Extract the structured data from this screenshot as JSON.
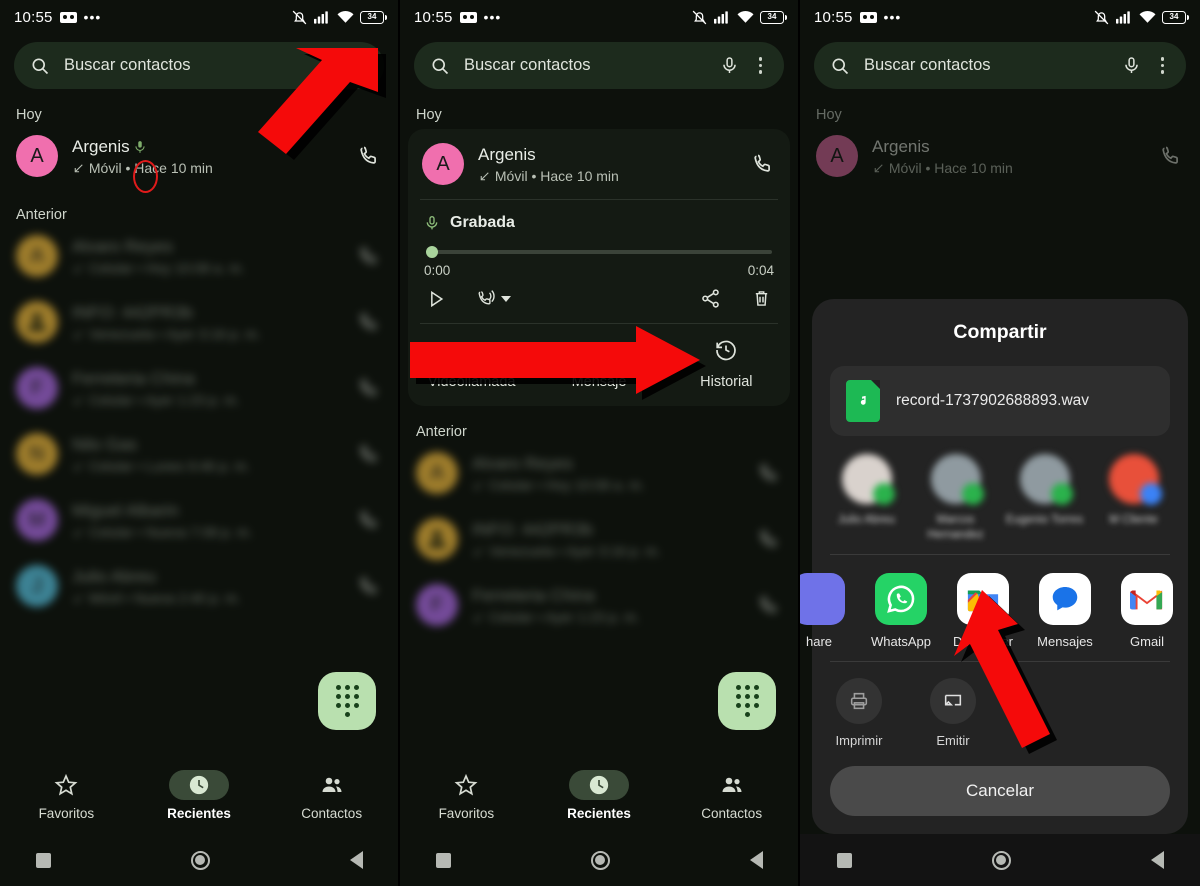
{
  "status_bar": {
    "time": "10:55",
    "battery_percent": "34",
    "icons": [
      "voicemail-tape-icon",
      "overflow-dots-icon",
      "ringer-off-icon",
      "signal-icon",
      "wifi-icon",
      "battery-icon"
    ]
  },
  "search": {
    "placeholder": "Buscar contactos",
    "icons": [
      "search-icon",
      "mic-icon",
      "kebab-menu-icon"
    ]
  },
  "sections": {
    "today": "Hoy",
    "previous": "Anterior"
  },
  "highlight_call": {
    "name": "Argenis",
    "subtitle": "Móvil • Hace 10 min",
    "avatar_letter": "A",
    "avatar_color": "#f06fae",
    "direction_icon": "incoming-call-arrow-icon",
    "recorded_icon": "mic-icon"
  },
  "recording": {
    "label": "Grabada",
    "time_start": "0:00",
    "time_end": "0:04",
    "progress_percent": 0,
    "controls": [
      "play-icon",
      "speaker-dropdown-icon",
      "share-icon",
      "delete-icon"
    ]
  },
  "call_actions": [
    {
      "label": "Videollamada",
      "icon": "video-camera-icon"
    },
    {
      "label": "Mensaje",
      "icon": "message-bubble-icon"
    },
    {
      "label": "Historial",
      "icon": "history-clock-icon"
    }
  ],
  "previous_calls": [
    {
      "letter": "A",
      "color": "#f7bf3f",
      "name": "Alvaro Reyes",
      "sub": "Celular • Hoy 10:08 a. m.",
      "type": "letter"
    },
    {
      "letter": "",
      "color": "#f7bf3f",
      "name": "INFO: 442PR3b",
      "sub": "Venezuela • Ayer 3:16 p. m.",
      "type": "person"
    },
    {
      "letter": "F",
      "color": "#b46ef0",
      "name": "Ferreteria China",
      "sub": "Celular • Ayer 1:23 p. m.",
      "type": "letter"
    },
    {
      "letter": "N",
      "color": "#f7bf3f",
      "name": "Nilo Gas",
      "sub": "Celular • Lunes 9:46 p. m.",
      "type": "letter"
    },
    {
      "letter": "M",
      "color": "#b46ef0",
      "name": "Miguel Albarin",
      "sub": "Celular • Nueva 7:08 p. m.",
      "type": "letter"
    },
    {
      "letter": "J",
      "color": "#5ac8e8",
      "name": "Julio Abreu",
      "sub": "Móvil • Nueva 2:40 p. m.",
      "type": "letter"
    }
  ],
  "bottom_nav": [
    {
      "label": "Favoritos",
      "icon": "star-icon",
      "active": false
    },
    {
      "label": "Recientes",
      "icon": "clock-icon",
      "active": true
    },
    {
      "label": "Contactos",
      "icon": "people-icon",
      "active": false
    }
  ],
  "system_nav": [
    "recents-square-icon",
    "home-circle-icon",
    "back-triangle-icon"
  ],
  "fab": {
    "icon": "dialpad-icon",
    "color": "#b9e0af"
  },
  "share_sheet": {
    "title": "Compartir",
    "file_name": "record-1737902688893.wav",
    "file_icon": "audio-file-icon",
    "suggestions": [
      {
        "label": "Julio Abreu",
        "color": "#d9d2cd",
        "badge": "#2bb24c"
      },
      {
        "label": "Marcos Hernandez",
        "color": "#8f9aa0",
        "badge": "#2bb24c"
      },
      {
        "label": "Eugenio Torres",
        "color": "#8f9aa0",
        "badge": "#2bb24c"
      },
      {
        "label": "M Cliente",
        "color": "#e8503a",
        "badge": "#3b82f6"
      }
    ],
    "apps": [
      {
        "label": "hare",
        "icon": "nearby-share-icon"
      },
      {
        "label": "WhatsApp",
        "icon": "whatsapp-icon"
      },
      {
        "label": "Descargar",
        "icon": "files-icon"
      },
      {
        "label": "Mensajes",
        "icon": "messages-icon"
      },
      {
        "label": "Gmail",
        "icon": "gmail-icon"
      }
    ],
    "system_actions": [
      {
        "label": "Imprimir",
        "icon": "printer-icon"
      },
      {
        "label": "Emitir",
        "icon": "cast-icon"
      }
    ],
    "cancel_label": "Cancelar"
  },
  "annotations": {
    "arrow_color": "#f50a0a",
    "circle_color": "#e01b1b",
    "arrow1_target": "kebab-menu-icon",
    "arrow2_target": "share-icon",
    "arrow3_target": "descargar-app"
  }
}
